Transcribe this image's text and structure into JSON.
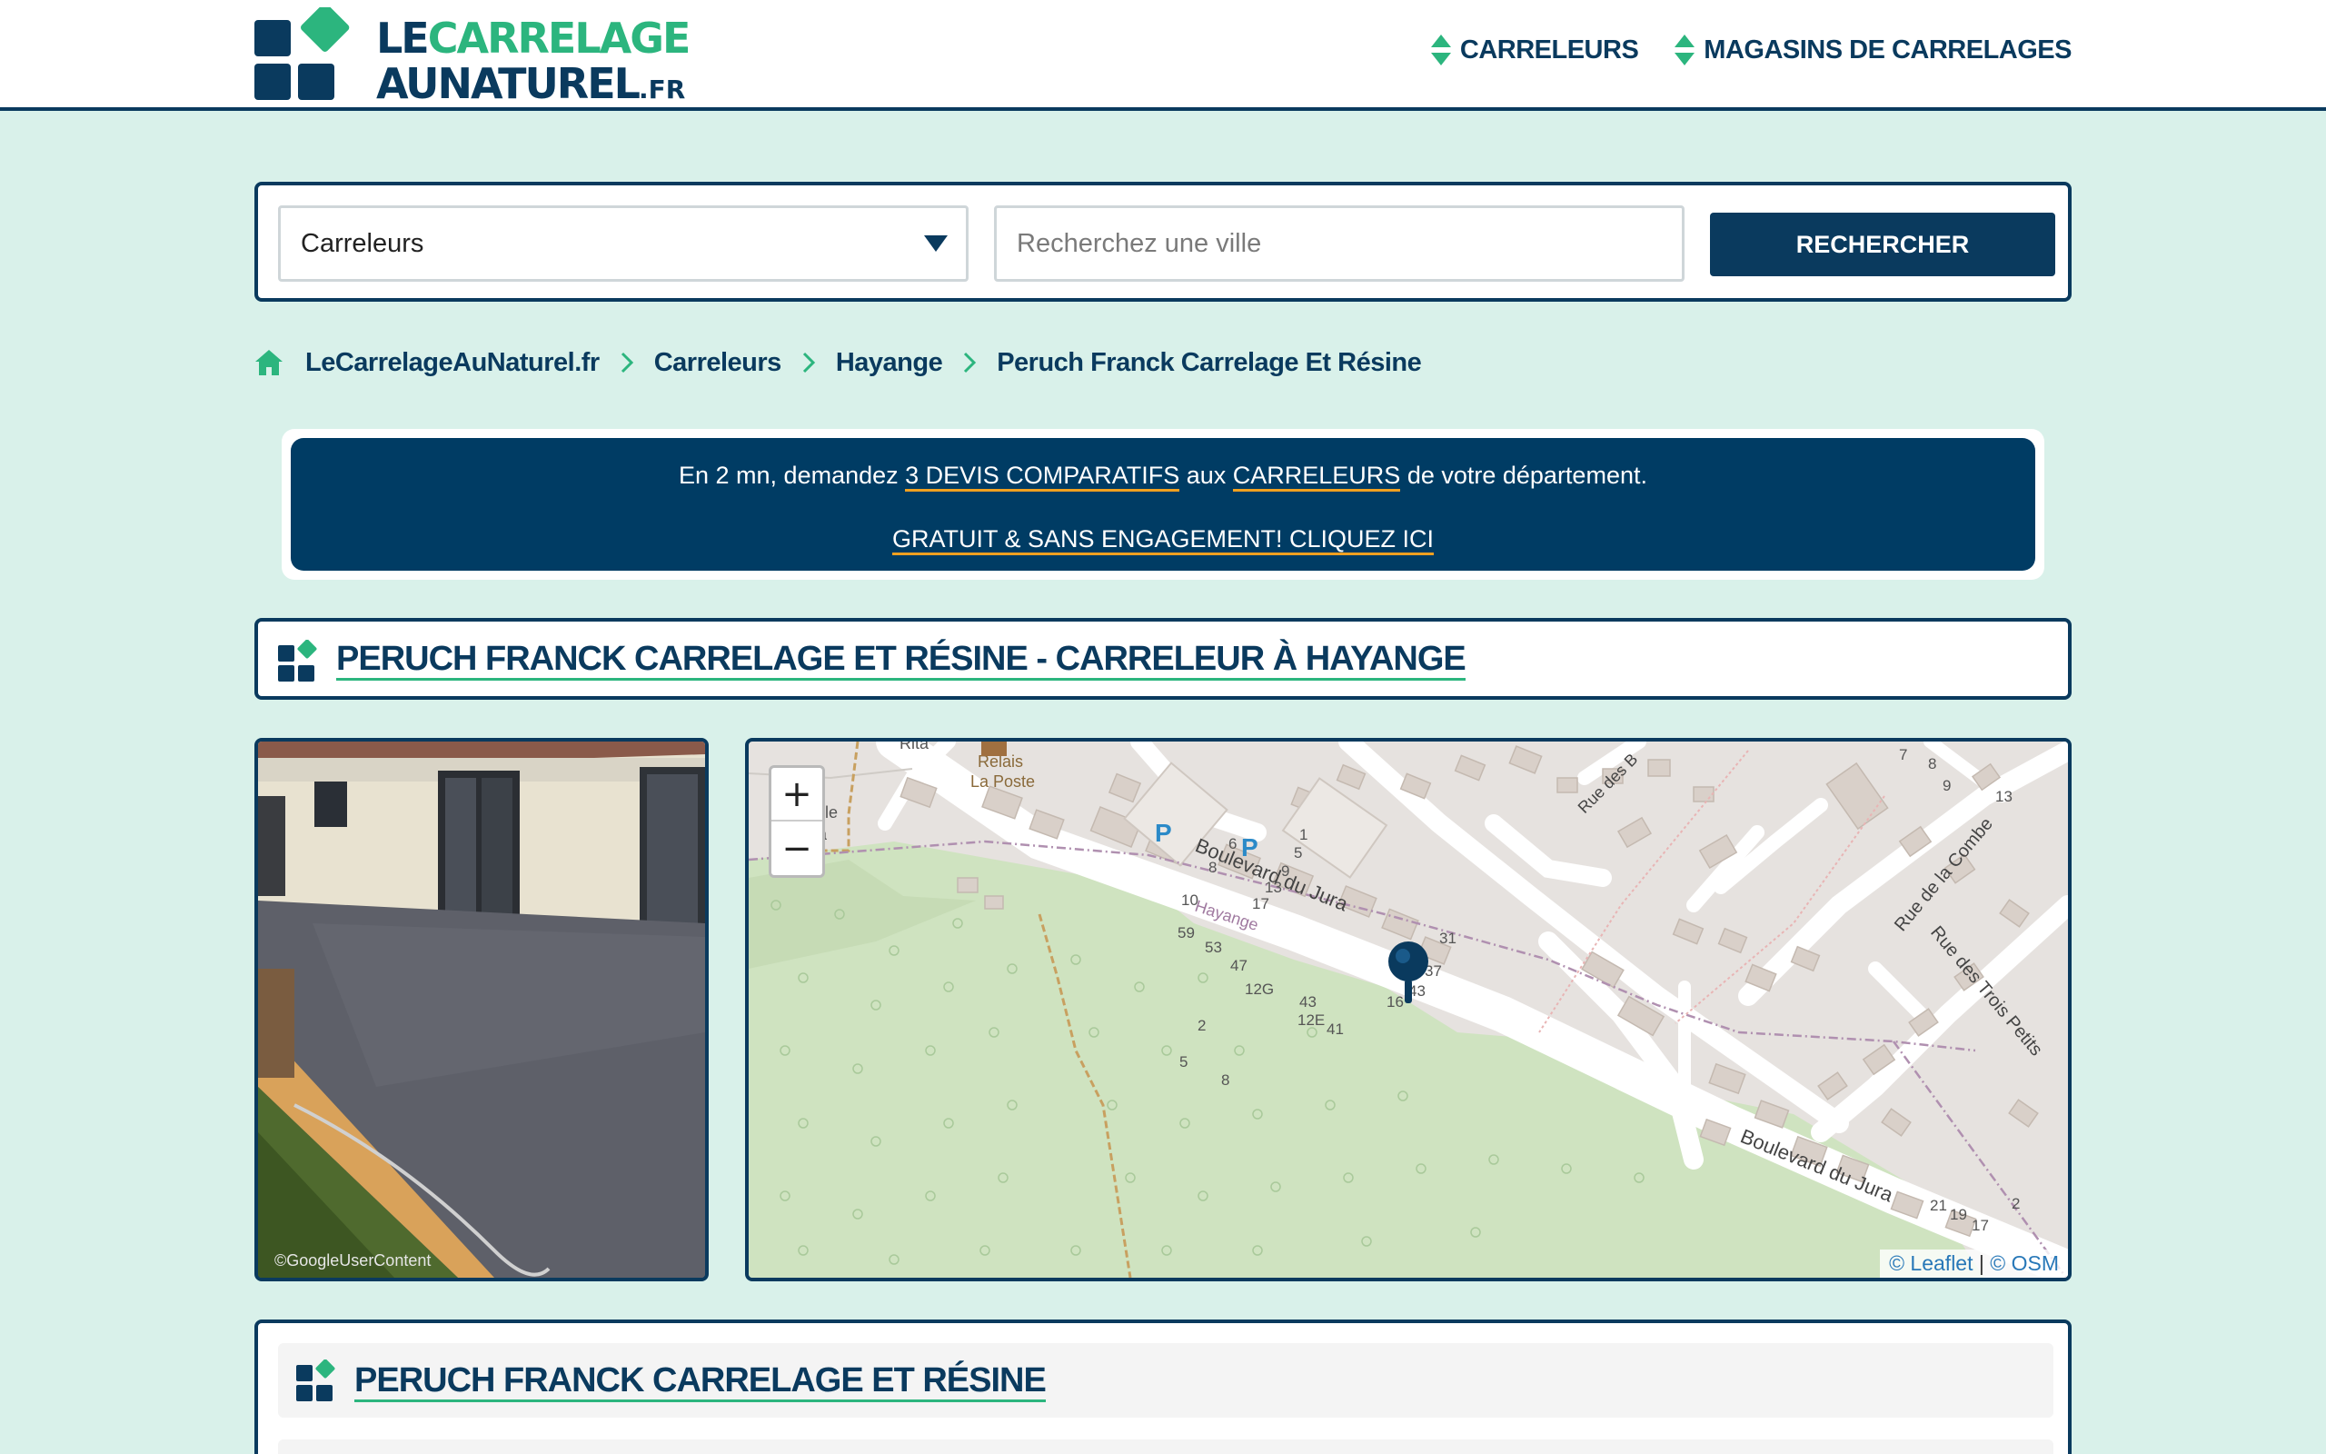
{
  "header": {
    "logo": {
      "line1_a": "LE",
      "line1_b": "CARRELAGE",
      "line2_a": "AUNATUREL",
      "line2_b": ".FR"
    },
    "nav": [
      {
        "label": "CARRELEURS"
      },
      {
        "label": "MAGASINS DE CARRELAGES"
      }
    ]
  },
  "search": {
    "category_selected": "Carreleurs",
    "city_placeholder": "Recherchez une ville",
    "button_label": "RECHERCHER"
  },
  "breadcrumb": [
    {
      "label": "LeCarrelageAuNaturel.fr"
    },
    {
      "label": "Carreleurs"
    },
    {
      "label": "Hayange"
    },
    {
      "label": "Peruch Franck Carrelage Et Résine"
    }
  ],
  "banner": {
    "text_1": "En 2 mn, demandez ",
    "link_1": "3 DEVIS COMPARATIFS",
    "text_2": " aux ",
    "link_2": "CARRELEURS",
    "text_3": " de votre département.",
    "cta": "GRATUIT & SANS ENGAGEMENT! CLIQUEZ ICI"
  },
  "page_title": "PERUCH FRANCK CARRELAGE ET RÉSINE - CARRELEUR À HAYANGE",
  "photo": {
    "credit": "©GoogleUserContent"
  },
  "map": {
    "zoom_in": "+",
    "zoom_out": "−",
    "attribution_leaflet": "© Leaflet",
    "attribution_sep": " | ",
    "attribution_osm": "© OSM",
    "labels": {
      "rita": "Rita",
      "relais": "Relais",
      "laposte": "La Poste",
      "le": "le",
      "nelle": "nelle",
      "ura": "ura",
      "boulevard1": "Boulevard du Jura",
      "boulevard2": "Boulevard du Jura",
      "hayange": "Hayange",
      "rue_des_b": "Rue des B",
      "rue_combe": "Rue de la Combe",
      "rue_trois": "Rue des Trois Petits",
      "parking": "P"
    },
    "house_numbers": [
      "7",
      "8",
      "9",
      "13",
      "6",
      "1",
      "5",
      "8",
      "9",
      "13",
      "10",
      "17",
      "59",
      "53",
      "47",
      "12G",
      "43",
      "12E",
      "41",
      "31",
      "37",
      "43",
      "16",
      "2",
      "5",
      "8",
      "21",
      "19",
      "17",
      "2"
    ]
  },
  "section": {
    "title": "PERUCH FRANCK CARRELAGE ET RÉSINE"
  },
  "colors": {
    "navy": "#0a3a5e",
    "green": "#2cb57e",
    "background": "#d9f1ea",
    "banner": "#003c64",
    "underline": "#f0a020"
  }
}
